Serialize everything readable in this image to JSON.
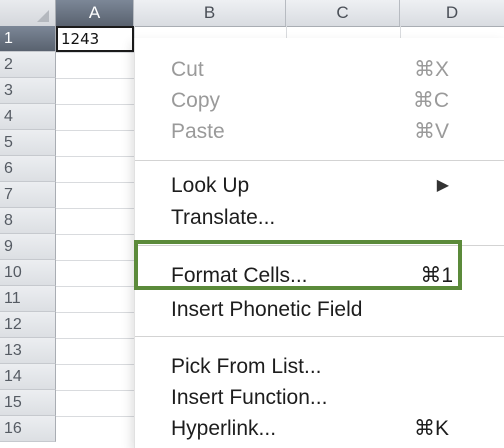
{
  "columns": [
    "A",
    "B",
    "C",
    "D"
  ],
  "rows": [
    "1",
    "2",
    "3",
    "4",
    "5",
    "6",
    "7",
    "8",
    "9",
    "10",
    "11",
    "12",
    "13",
    "14",
    "15",
    "16"
  ],
  "cell_a1": {
    "value": "1243"
  },
  "context_menu": {
    "groups": [
      [
        {
          "label": "Cut",
          "shortcut": "⌘X",
          "disabled": true
        },
        {
          "label": "Copy",
          "shortcut": "⌘C",
          "disabled": true
        },
        {
          "label": "Paste",
          "shortcut": "⌘V",
          "disabled": true
        }
      ],
      [
        {
          "label": "Look Up",
          "submenu": "▶"
        },
        {
          "label": "Translate..."
        }
      ],
      [
        {
          "label": "Format Cells...",
          "shortcut": "⌘1"
        },
        {
          "label": "Insert Phonetic Field"
        }
      ],
      [
        {
          "label": "Pick From List..."
        },
        {
          "label": "Insert Function..."
        },
        {
          "label": "Hyperlink...",
          "shortcut": "⌘K"
        }
      ]
    ]
  },
  "colors": {
    "highlight": "#5b8a3a",
    "selected_header": "#59626f"
  }
}
